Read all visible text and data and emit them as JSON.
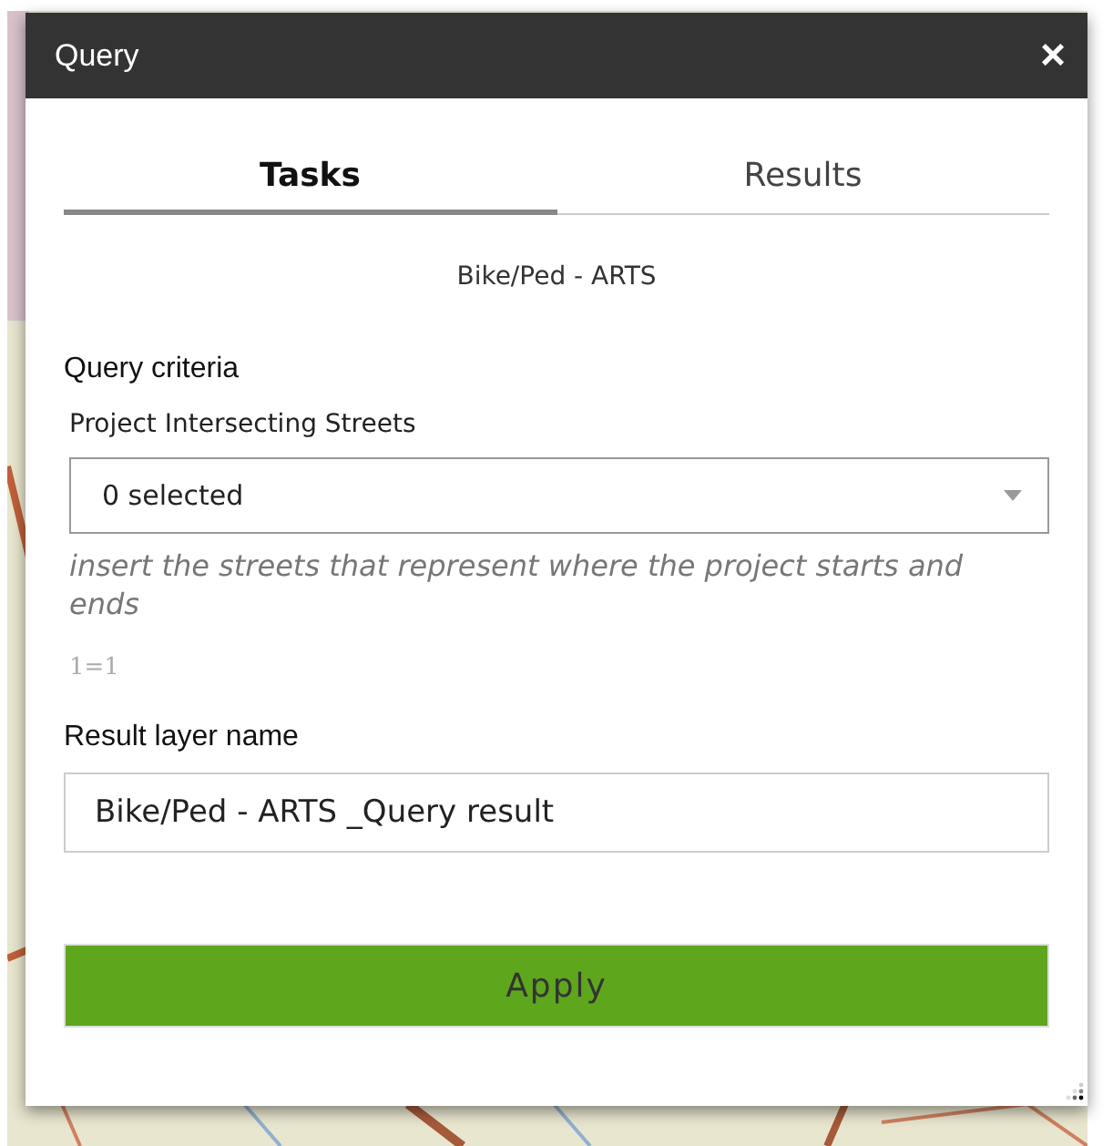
{
  "window": {
    "title": "Query",
    "close": "×"
  },
  "tabs": [
    {
      "label": "Tasks",
      "selected": true
    },
    {
      "label": "Results",
      "selected": false
    }
  ],
  "task_name": "Bike/Ped - ARTS",
  "criteria": {
    "heading": "Query criteria",
    "label": "Project Intersecting Streets",
    "value": "0 selected",
    "hint": "insert the streets that represent where the project starts and ends",
    "expression": "1=1"
  },
  "result_layer": {
    "label": "Result layer name",
    "value": "Bike/Ped - ARTS _Query result"
  },
  "apply_button": "Apply"
}
